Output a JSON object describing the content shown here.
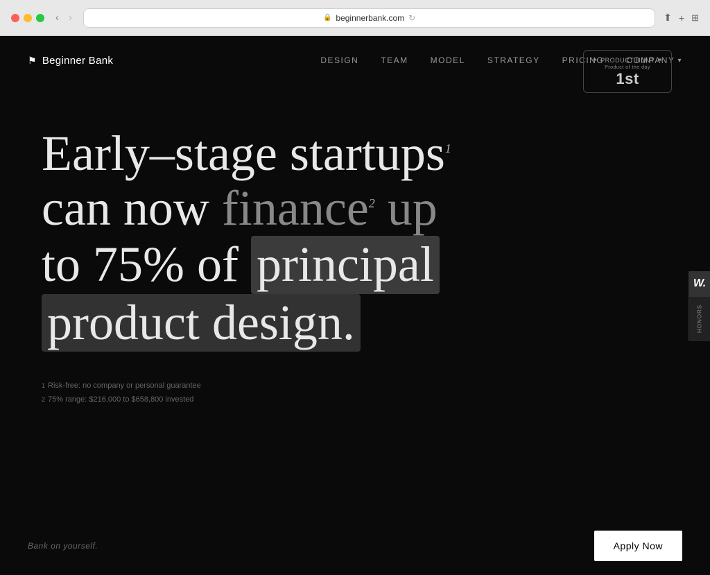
{
  "browser": {
    "url": "beginnerbank.com",
    "back_disabled": false,
    "forward_disabled": true
  },
  "nav": {
    "logo_text": "Beginner Bank",
    "links": [
      {
        "id": "design",
        "label": "DESIGN"
      },
      {
        "id": "team",
        "label": "TEAM"
      },
      {
        "id": "model",
        "label": "MODEL"
      },
      {
        "id": "strategy",
        "label": "STRATEGY"
      },
      {
        "id": "pricing",
        "label": "PRICING"
      },
      {
        "id": "company",
        "label": "COMPANY"
      }
    ]
  },
  "product_hunt": {
    "label": "PRODUCT HUNT",
    "subtitle": "Product of the day",
    "rank": "1st"
  },
  "hero": {
    "line1": "Early–stage startups",
    "sup1": "1",
    "line2": "can now finance",
    "sup2": "2",
    "line2b": " up",
    "line3": "to 75% of ",
    "highlight1": "principal",
    "line4": "product design."
  },
  "footnotes": {
    "fn1_super": "1",
    "fn1_text": "Risk-free: no company or personal guarantee",
    "fn2_super": "2",
    "fn2_text": "75% range: $216,000 to $658,800 invested"
  },
  "side_widget": {
    "letter": "W.",
    "honors": "Honors"
  },
  "bottom": {
    "tagline": "Bank on yourself.",
    "apply_label": "Apply Now"
  }
}
